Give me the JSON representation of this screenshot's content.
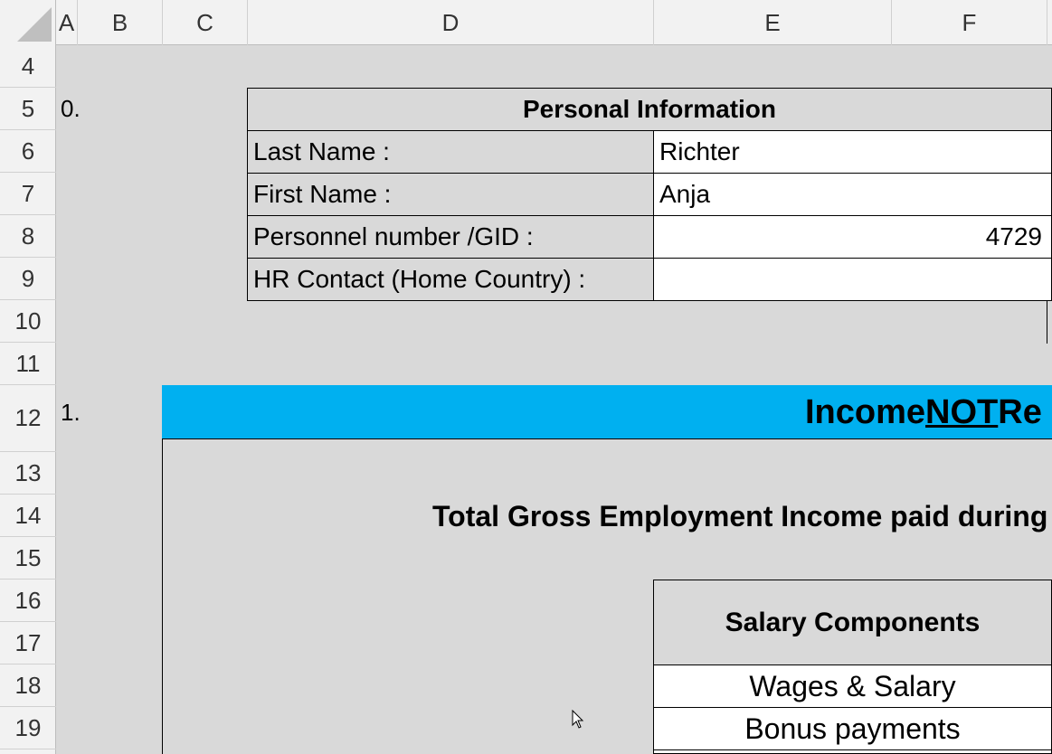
{
  "columns": [
    "A",
    "B",
    "C",
    "D",
    "E",
    "F"
  ],
  "rows": [
    "4",
    "5",
    "6",
    "7",
    "8",
    "9",
    "10",
    "11",
    "12",
    "13",
    "14",
    "15",
    "16",
    "17",
    "18",
    "19"
  ],
  "sections": {
    "personal_number": "0.",
    "income_number": "1."
  },
  "personal_info": {
    "title": "Personal Information",
    "fields": [
      {
        "label": "Last Name :",
        "value": "Richter"
      },
      {
        "label": "First Name :",
        "value": "Anja"
      },
      {
        "label": "Personnel number /GID :",
        "value": "4729"
      },
      {
        "label": "HR Contact (Home Country) :",
        "value": ""
      }
    ]
  },
  "income": {
    "title_part1": "Income ",
    "title_part2": "NOT",
    "title_part3": " Re",
    "gross_title": "Total Gross Employment Income paid during",
    "components_header": "Salary Components",
    "components": [
      "Wages & Salary",
      "Bonus payments"
    ]
  }
}
